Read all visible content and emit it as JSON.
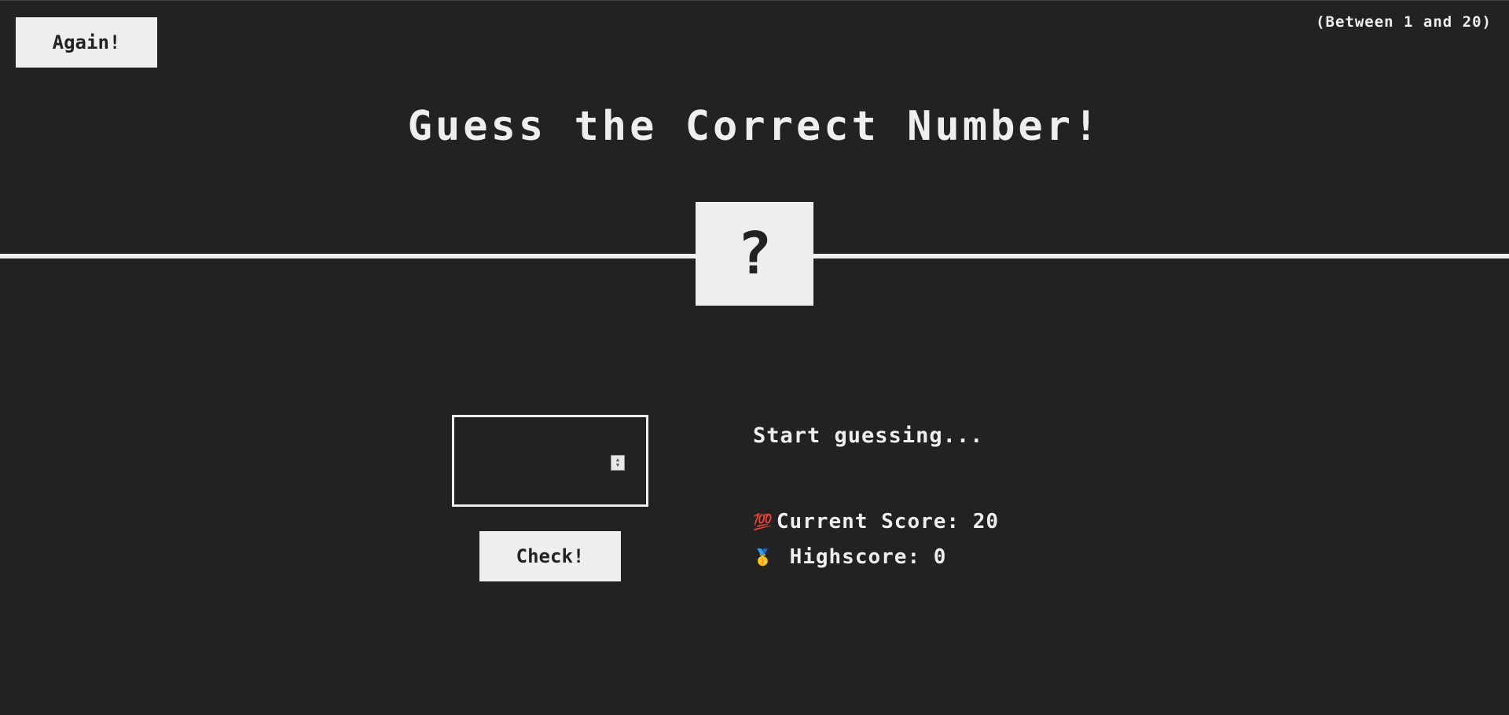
{
  "header": {
    "again_label": "Again!",
    "range_hint": "(Between 1 and 20)",
    "title": "Guess the Correct Number!"
  },
  "secret": {
    "display": "?"
  },
  "left": {
    "guess_value": "",
    "check_label": "Check!"
  },
  "right": {
    "message": "Start guessing...",
    "score_icon": "💯",
    "score_label": "Current Score:",
    "score_value": "20",
    "highscore_icon": "🥇",
    "highscore_label": "Highscore:",
    "highscore_value": "0"
  },
  "colors": {
    "background": "#222222",
    "foreground": "#eeeeee"
  }
}
